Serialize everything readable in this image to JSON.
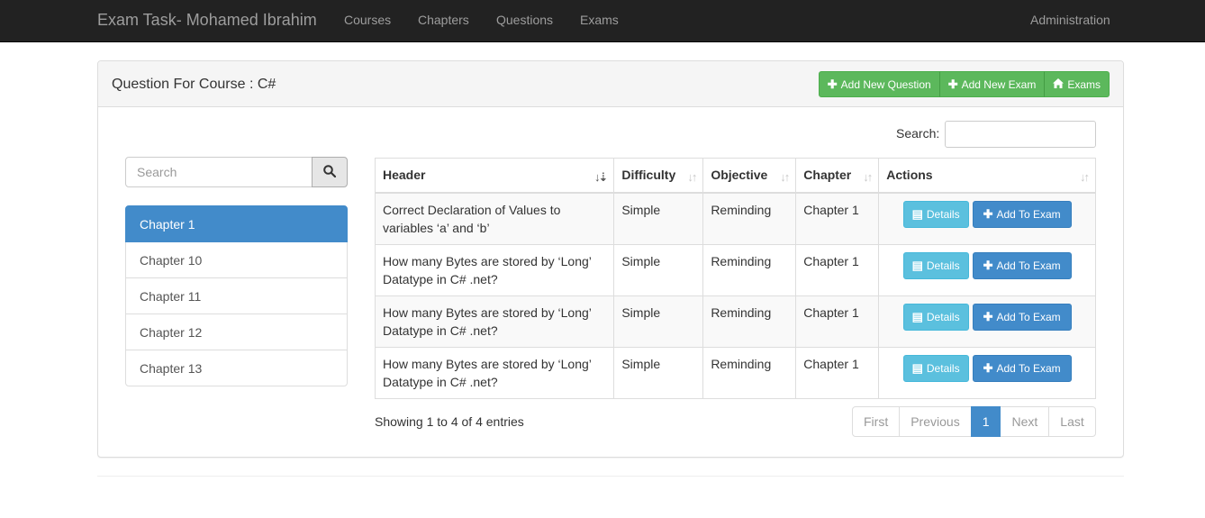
{
  "navbar": {
    "brand": "Exam Task- Mohamed Ibrahim",
    "links": [
      "Courses",
      "Chapters",
      "Questions",
      "Exams"
    ],
    "right_link": "Administration"
  },
  "panel": {
    "title": "Question For Course : C#",
    "buttons": {
      "add_question": "Add New Question",
      "add_exam": "Add New Exam",
      "exams": "Exams"
    }
  },
  "sidebar": {
    "search_placeholder": "Search",
    "chapters": [
      "Chapter 1",
      "Chapter 10",
      "Chapter 11",
      "Chapter 12",
      "Chapter 13"
    ],
    "active_chapter": "Chapter 1"
  },
  "table": {
    "search_label": "Search:",
    "search_value": "",
    "columns": [
      "Header",
      "Difficulty",
      "Objective",
      "Chapter",
      "Actions"
    ],
    "rows": [
      {
        "header": "Correct Declaration of Values to variables ‘a’ and ‘b’",
        "difficulty": "Simple",
        "objective": "Reminding",
        "chapter": "Chapter 1"
      },
      {
        "header": "How many Bytes are stored by ‘Long’ Datatype in C# .net?",
        "difficulty": "Simple",
        "objective": "Reminding",
        "chapter": "Chapter 1"
      },
      {
        "header": "How many Bytes are stored by ‘Long’ Datatype in C# .net?",
        "difficulty": "Simple",
        "objective": "Reminding",
        "chapter": "Chapter 1"
      },
      {
        "header": "How many Bytes are stored by ‘Long’ Datatype in C# .net?",
        "difficulty": "Simple",
        "objective": "Reminding",
        "chapter": "Chapter 1"
      }
    ],
    "details_label": "Details",
    "add_to_exam_label": "Add To Exam",
    "info": "Showing 1 to 4 of 4 entries"
  },
  "pagination": {
    "first": "First",
    "previous": "Previous",
    "current": "1",
    "next": "Next",
    "last": "Last"
  },
  "colors": {
    "navbar_bg": "#222222",
    "primary": "#428bca",
    "success": "#5cb85c",
    "info": "#5bc0de"
  }
}
